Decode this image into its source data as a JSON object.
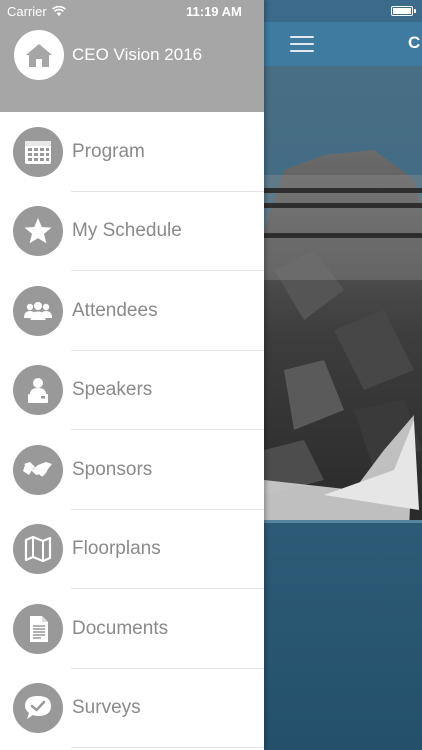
{
  "status_bar": {
    "carrier": "Carrier",
    "time": "11:19 AM"
  },
  "header": {
    "title": "CEO Vision 2016",
    "icon": "home-icon"
  },
  "menu": [
    {
      "label": "Program",
      "icon": "calendar-icon"
    },
    {
      "label": "My Schedule",
      "icon": "star-icon"
    },
    {
      "label": "Attendees",
      "icon": "people-icon"
    },
    {
      "label": "Speakers",
      "icon": "speaker-icon"
    },
    {
      "label": "Sponsors",
      "icon": "handshake-icon"
    },
    {
      "label": "Floorplans",
      "icon": "map-icon"
    },
    {
      "label": "Documents",
      "icon": "document-icon"
    },
    {
      "label": "Surveys",
      "icon": "speech-check-icon"
    }
  ],
  "background_app": {
    "nav_initial": "C",
    "menu_icon": "hamburger-icon"
  },
  "colors": {
    "drawer_header": "#a6a6a6",
    "icon_circle": "#999999",
    "label_gray": "#8a8a8a",
    "nav_blue": "#3f7aa1"
  }
}
